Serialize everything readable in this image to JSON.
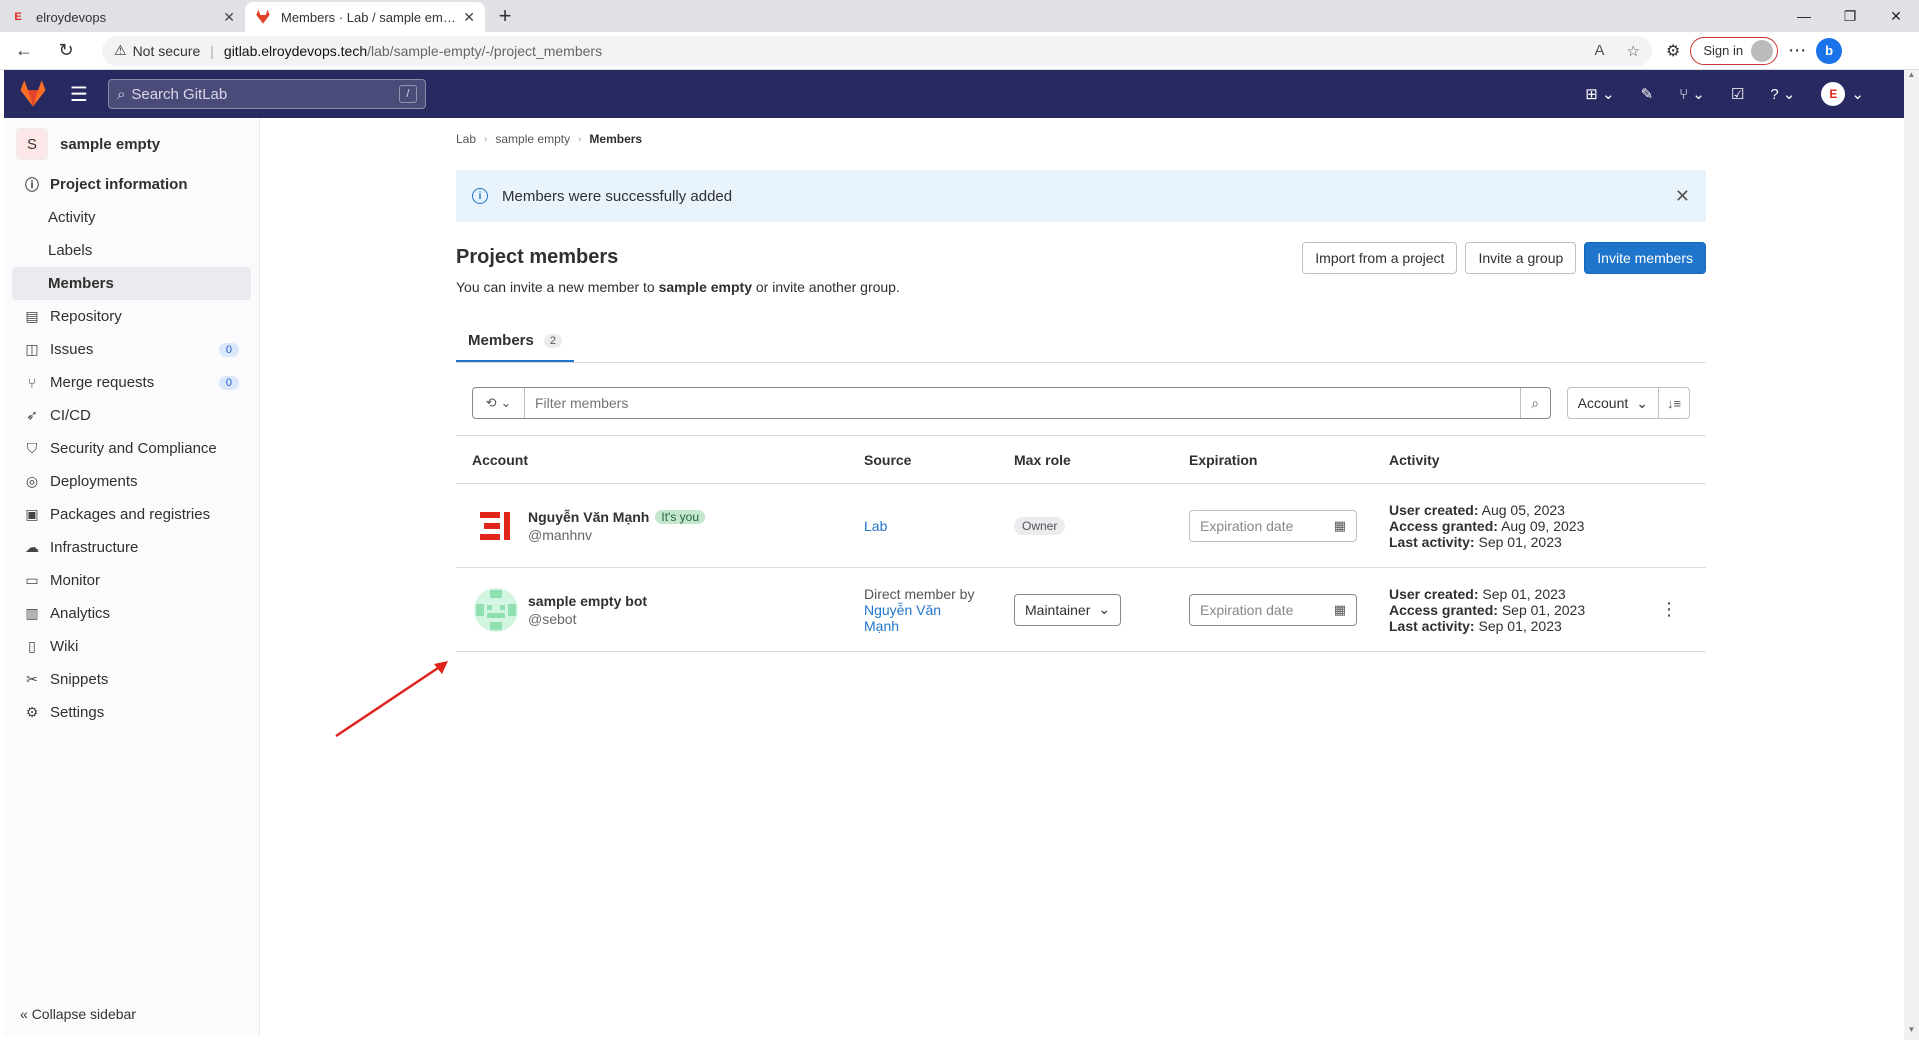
{
  "browser": {
    "tabs": [
      {
        "title": "elroydevops",
        "active": false
      },
      {
        "title": "Members · Lab / sample empty ·",
        "active": true
      }
    ],
    "url_host": "gitlab.elroydevops.tech",
    "url_path": "/lab/sample-empty/-/project_members",
    "not_secure": "Not secure",
    "sign_in": "Sign in"
  },
  "header": {
    "search_placeholder": "Search GitLab",
    "search_shortcut": "/"
  },
  "sidebar": {
    "project_initial": "S",
    "project_name": "sample empty",
    "items": [
      {
        "label": "Project information",
        "icon": "info-icon"
      },
      {
        "label": "Activity"
      },
      {
        "label": "Labels"
      },
      {
        "label": "Members"
      },
      {
        "label": "Repository",
        "icon": "doc-icon"
      },
      {
        "label": "Issues",
        "icon": "issues-icon",
        "count": "0"
      },
      {
        "label": "Merge requests",
        "icon": "merge-icon",
        "count": "0"
      },
      {
        "label": "CI/CD",
        "icon": "rocket-icon"
      },
      {
        "label": "Security and Compliance",
        "icon": "shield-icon"
      },
      {
        "label": "Deployments",
        "icon": "deploy-icon"
      },
      {
        "label": "Packages and registries",
        "icon": "package-icon"
      },
      {
        "label": "Infrastructure",
        "icon": "cloud-icon"
      },
      {
        "label": "Monitor",
        "icon": "monitor-icon"
      },
      {
        "label": "Analytics",
        "icon": "chart-icon"
      },
      {
        "label": "Wiki",
        "icon": "book-icon"
      },
      {
        "label": "Snippets",
        "icon": "scissors-icon"
      },
      {
        "label": "Settings",
        "icon": "gear-icon"
      }
    ],
    "collapse": "Collapse sidebar"
  },
  "main": {
    "breadcrumb": [
      "Lab",
      "sample empty",
      "Members"
    ],
    "alert": "Members were successfully added",
    "title": "Project members",
    "desc_prefix": "You can invite a new member to ",
    "desc_project": "sample empty",
    "desc_suffix": " or invite another group.",
    "buttons": {
      "import": "Import from a project",
      "invite_group": "Invite a group",
      "invite_members": "Invite members"
    },
    "tab_label": "Members",
    "tab_count": "2",
    "filter_placeholder": "Filter members",
    "sort_label": "Account",
    "columns": [
      "Account",
      "Source",
      "Max role",
      "Expiration",
      "Activity"
    ],
    "rows": [
      {
        "name": "Nguyễn Văn Mạnh",
        "its_you": "It's you",
        "handle": "@manhnv",
        "source": "Lab",
        "role": "Owner",
        "expiration_placeholder": "Expiration date",
        "created_label": "User created:",
        "created": "Aug 05, 2023",
        "granted_label": "Access granted:",
        "granted": "Aug 09, 2023",
        "last_label": "Last activity:",
        "last": "Sep 01, 2023"
      },
      {
        "name": "sample empty bot",
        "handle": "@sebot",
        "source_prefix": "Direct member by",
        "source_link": "Nguyễn Văn Mạnh",
        "role": "Maintainer",
        "expiration_placeholder": "Expiration date",
        "created_label": "User created:",
        "created": "Sep 01, 2023",
        "granted_label": "Access granted:",
        "granted": "Sep 01, 2023",
        "last_label": "Last activity:",
        "last": "Sep 01, 2023"
      }
    ]
  },
  "colors": {
    "header": "#292961",
    "primary": "#1f75cb",
    "alert_bg": "#e9f3fc",
    "arrow": "#e0241b"
  }
}
